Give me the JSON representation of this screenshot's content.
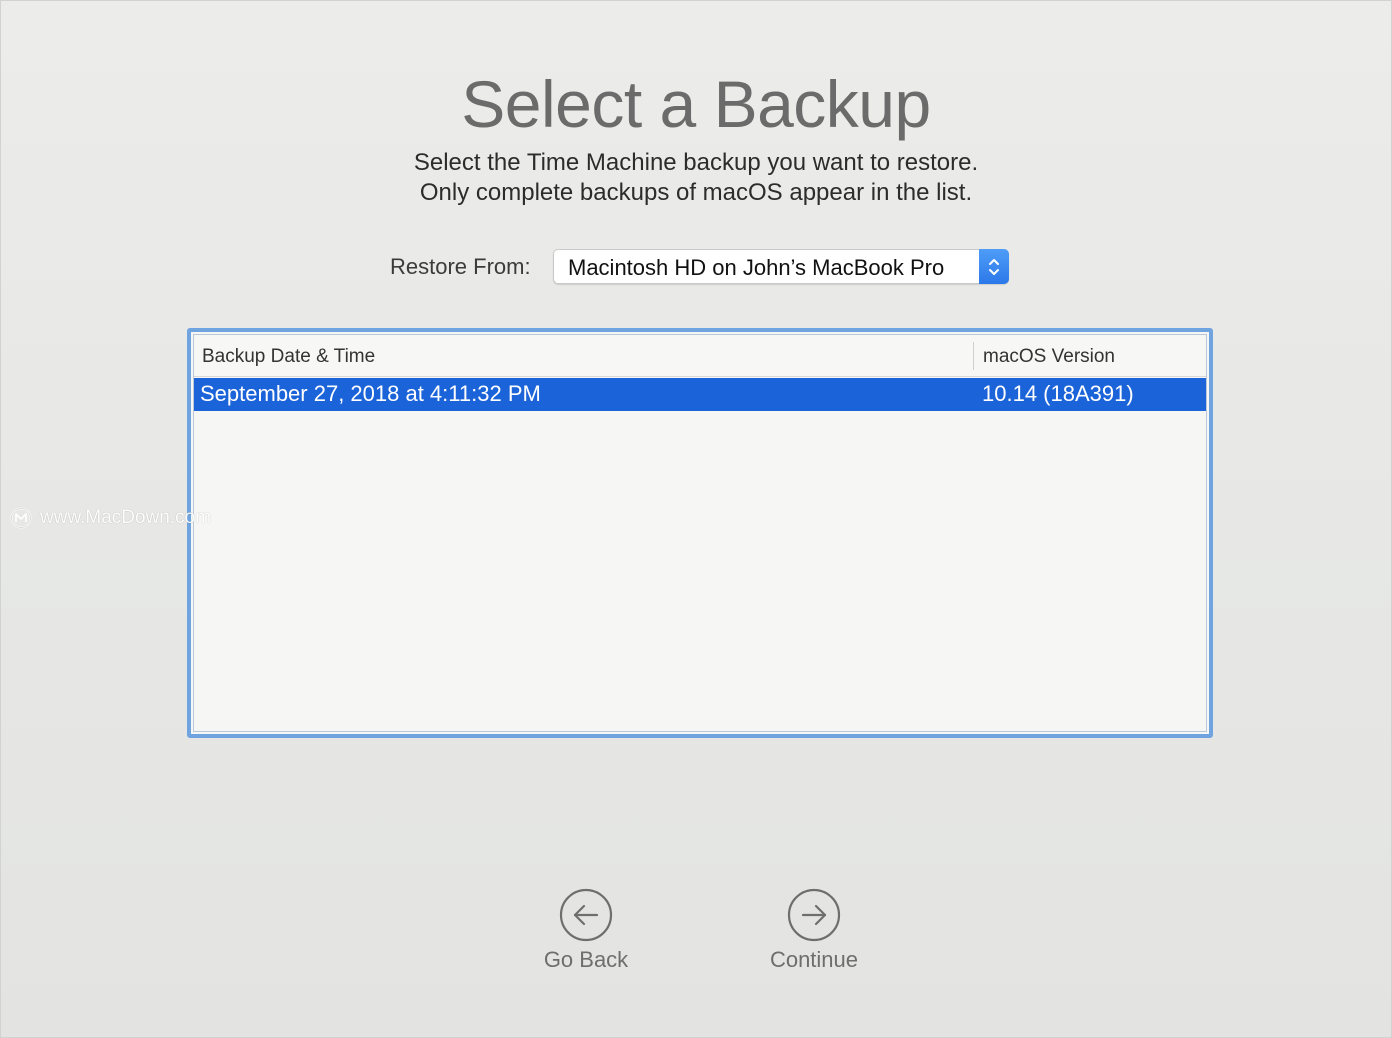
{
  "header": {
    "title": "Select a Backup",
    "subtitle_line1": "Select the Time Machine backup you want to restore.",
    "subtitle_line2": "Only complete backups of macOS appear in the list."
  },
  "restore_from": {
    "label": "Restore From:",
    "selected_value": "Macintosh HD on John’s MacBook Pro",
    "stepper_icon": "up-down-chevrons-icon"
  },
  "backup_table": {
    "columns": [
      "Backup Date & Time",
      "macOS Version"
    ],
    "rows": [
      {
        "date_time": "September 27, 2018 at 4:11:32 PM",
        "version": "10.14 (18A391)",
        "selected": true
      }
    ]
  },
  "watermark": {
    "text": "www.MacDown.com"
  },
  "navigation": {
    "back_label": "Go Back",
    "back_icon": "arrow-left-circle-icon",
    "continue_label": "Continue",
    "continue_icon": "arrow-right-circle-icon"
  },
  "colors": {
    "accent": "#1b63d8",
    "focus_ring": "#6fa4e0",
    "stepper": "#2b78ea"
  }
}
